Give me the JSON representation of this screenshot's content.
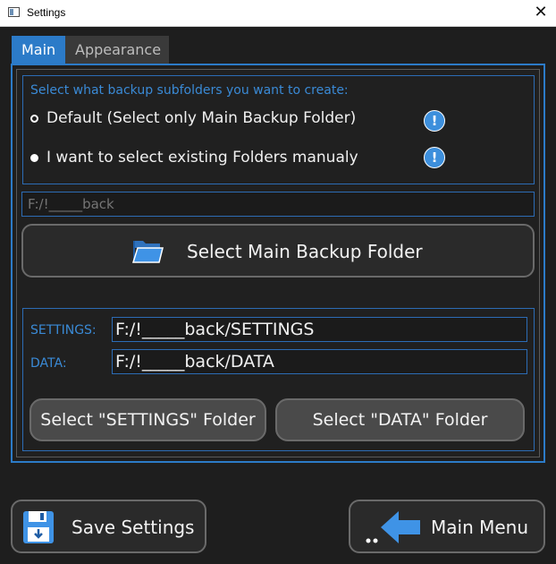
{
  "window": {
    "title": "Settings",
    "close_symbol": "✕",
    "icon": "app-window-icon"
  },
  "tabs": [
    {
      "label": "Main",
      "active": true
    },
    {
      "label": "Appearance",
      "active": false
    }
  ],
  "subfolders": {
    "heading": "Select what backup subfolders you want to create:",
    "options": [
      {
        "label": "Default (Select only Main Backup Folder)",
        "selected": false,
        "info_icon": "info-icon"
      },
      {
        "label": "I want to select existing Folders manualy",
        "selected": true,
        "info_icon": "info-icon"
      }
    ]
  },
  "main_folder": {
    "path_placeholder": "F:/!_____back",
    "button_label": "Select Main Backup Folder",
    "button_icon": "folder-open-icon"
  },
  "folders": {
    "settings_label": "SETTINGS:",
    "settings_value": "F:/!_____back/SETTINGS",
    "data_label": "DATA:",
    "data_value": "F:/!_____back/DATA",
    "select_settings_label": "Select \"SETTINGS\" Folder",
    "select_data_label": "Select \"DATA\" Folder"
  },
  "footer": {
    "save_label": "Save Settings",
    "save_icon": "floppy-disk-icon",
    "main_menu_label": "Main Menu",
    "main_menu_icon": "arrow-left-icon"
  },
  "colors": {
    "accent": "#2c7bc8",
    "label_blue": "#3a8ad6",
    "background": "#1e1e1e"
  }
}
